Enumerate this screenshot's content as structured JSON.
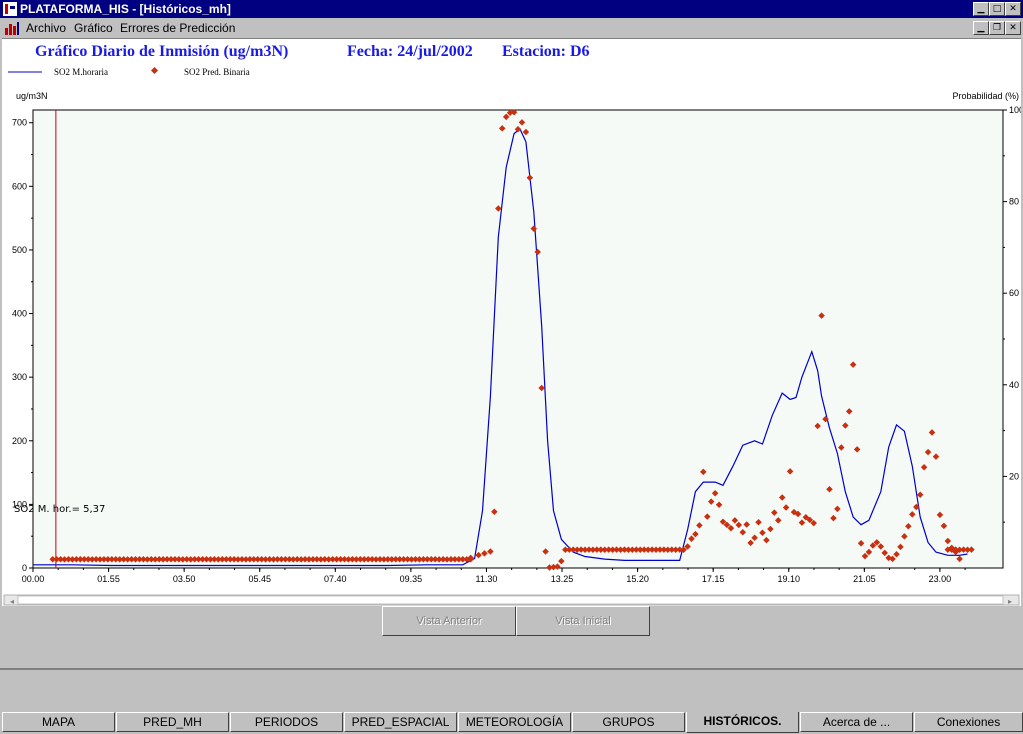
{
  "window": {
    "title": "PLATAFORMA_HIS - [Históricos_mh]"
  },
  "menu": {
    "archivo": "Archivo",
    "grafico": "Gráfico",
    "errores": "Errores de Predicción"
  },
  "chart_header": {
    "title": "Gráfico Diario de Inmisión (ug/m3N)",
    "fecha": "Fecha: 24/jul/2002",
    "estacion": "Estacion: D6"
  },
  "legend": {
    "line_label": "SO2 M.horaria",
    "dot_label": "SO2 Pred. Binaria",
    "line_color": "#0000cc",
    "dot_color": "#c83010"
  },
  "axes": {
    "left_unit": "ug/m3N",
    "right_unit": "Probabilidad (%)"
  },
  "cursor": {
    "readout": "SO2 M. hor.= 5,37"
  },
  "buttons": {
    "prev": "Vista Anterior",
    "initial": "Vista Inicial"
  },
  "tabs": [
    "MAPA",
    "PRED_MH",
    "PERIODOS",
    "PRED_ESPACIAL",
    "METEOROLOGÍA",
    "GRUPOS",
    "HISTÓRICOS.",
    "Acerca de ...",
    "Conexiones"
  ],
  "chart_data": {
    "type": "line",
    "x_unit": "hours",
    "x_ticks": [
      "00.00",
      "01.55",
      "03.50",
      "05.45",
      "07.40",
      "09.35",
      "11.30",
      "13.25",
      "15.20",
      "17.15",
      "19.10",
      "21.05",
      "23.00"
    ],
    "y_left": {
      "min": 0,
      "max": 720,
      "ticks": [
        0,
        100,
        200,
        300,
        400,
        500,
        600,
        700
      ]
    },
    "y_right": {
      "min": 0,
      "max": 100,
      "ticks": [
        20,
        40,
        60,
        80,
        100
      ]
    },
    "cursor_x": 0.58,
    "series": [
      {
        "name": "SO2 M.horaria",
        "axis": "left",
        "style": "line",
        "points": [
          [
            0,
            5
          ],
          [
            1,
            5
          ],
          [
            2,
            4
          ],
          [
            4,
            4
          ],
          [
            6,
            4
          ],
          [
            8,
            4
          ],
          [
            9,
            4
          ],
          [
            10,
            5
          ],
          [
            10.9,
            5
          ],
          [
            11.2,
            15
          ],
          [
            11.4,
            90
          ],
          [
            11.6,
            270
          ],
          [
            11.8,
            520
          ],
          [
            12,
            630
          ],
          [
            12.2,
            683
          ],
          [
            12.35,
            690
          ],
          [
            12.5,
            670
          ],
          [
            12.7,
            560
          ],
          [
            12.9,
            380
          ],
          [
            13.05,
            200
          ],
          [
            13.2,
            90
          ],
          [
            13.4,
            45
          ],
          [
            13.7,
            25
          ],
          [
            14,
            18
          ],
          [
            14.5,
            14
          ],
          [
            15,
            12
          ],
          [
            15.5,
            12
          ],
          [
            16,
            12
          ],
          [
            16.4,
            12
          ],
          [
            16.6,
            60
          ],
          [
            16.8,
            120
          ],
          [
            17,
            135
          ],
          [
            17.3,
            135
          ],
          [
            17.5,
            130
          ],
          [
            17.75,
            160
          ],
          [
            18,
            193
          ],
          [
            18.3,
            200
          ],
          [
            18.5,
            195
          ],
          [
            18.75,
            240
          ],
          [
            19,
            275
          ],
          [
            19.2,
            265
          ],
          [
            19.35,
            268
          ],
          [
            19.5,
            300
          ],
          [
            19.75,
            340
          ],
          [
            19.9,
            310
          ],
          [
            20,
            270
          ],
          [
            20.2,
            220
          ],
          [
            20.4,
            180
          ],
          [
            20.6,
            120
          ],
          [
            20.8,
            80
          ],
          [
            21,
            68
          ],
          [
            21.2,
            75
          ],
          [
            21.5,
            120
          ],
          [
            21.7,
            190
          ],
          [
            21.9,
            225
          ],
          [
            22.1,
            215
          ],
          [
            22.3,
            160
          ],
          [
            22.5,
            80
          ],
          [
            22.7,
            40
          ],
          [
            22.9,
            25
          ],
          [
            23.2,
            20
          ],
          [
            23.5,
            20
          ],
          [
            23.7,
            22
          ]
        ]
      },
      {
        "name": "SO2 Pred. Binaria",
        "axis": "right",
        "style": "markers",
        "uniform": [
          {
            "from": 0.5,
            "to": 11.1,
            "step": 0.1,
            "value": 1.9
          },
          {
            "from": 13.5,
            "to": 16.5,
            "step": 0.1,
            "value": 4.0
          },
          {
            "from": 23.2,
            "to": 23.8,
            "step": 0.1,
            "value": 4.0
          }
        ],
        "points": [
          [
            11.1,
            2.2
          ],
          [
            11.3,
            2.8
          ],
          [
            11.45,
            3.2
          ],
          [
            11.6,
            3.6
          ],
          [
            11.7,
            12.3
          ],
          [
            11.8,
            78.5
          ],
          [
            11.9,
            96.0
          ],
          [
            12.0,
            98.5
          ],
          [
            12.1,
            99.4
          ],
          [
            12.2,
            99.5
          ],
          [
            12.3,
            95.8
          ],
          [
            12.4,
            97.3
          ],
          [
            12.5,
            95.2
          ],
          [
            12.6,
            85.2
          ],
          [
            12.7,
            74.1
          ],
          [
            12.8,
            69.0
          ],
          [
            12.9,
            39.3
          ],
          [
            13.0,
            3.6
          ],
          [
            13.1,
            0.1
          ],
          [
            13.2,
            0.2
          ],
          [
            13.3,
            0.3
          ],
          [
            13.4,
            1.5
          ],
          [
            16.6,
            4.7
          ],
          [
            16.7,
            6.4
          ],
          [
            16.8,
            7.4
          ],
          [
            16.9,
            9.3
          ],
          [
            17.0,
            21.0
          ],
          [
            17.1,
            11.2
          ],
          [
            17.2,
            14.5
          ],
          [
            17.3,
            16.3
          ],
          [
            17.4,
            13.8
          ],
          [
            17.5,
            10.1
          ],
          [
            17.6,
            9.4
          ],
          [
            17.7,
            8.7
          ],
          [
            17.8,
            10.4
          ],
          [
            17.9,
            9.4
          ],
          [
            18.0,
            7.8
          ],
          [
            18.1,
            9.5
          ],
          [
            18.2,
            5.5
          ],
          [
            18.3,
            6.6
          ],
          [
            18.4,
            10.0
          ],
          [
            18.5,
            7.7
          ],
          [
            18.6,
            6.1
          ],
          [
            18.7,
            8.5
          ],
          [
            18.8,
            12.1
          ],
          [
            18.9,
            10.4
          ],
          [
            19.0,
            15.4
          ],
          [
            19.1,
            13.2
          ],
          [
            19.2,
            21.1
          ],
          [
            19.3,
            12.2
          ],
          [
            19.4,
            11.8
          ],
          [
            19.5,
            9.9
          ],
          [
            19.6,
            11.1
          ],
          [
            19.7,
            10.5
          ],
          [
            19.8,
            9.8
          ],
          [
            19.9,
            31.0
          ],
          [
            20.0,
            55.1
          ],
          [
            20.1,
            32.5
          ],
          [
            20.2,
            17.2
          ],
          [
            20.3,
            10.9
          ],
          [
            20.4,
            12.9
          ],
          [
            20.5,
            26.3
          ],
          [
            20.6,
            31.1
          ],
          [
            20.7,
            34.2
          ],
          [
            20.8,
            44.4
          ],
          [
            20.9,
            25.9
          ],
          [
            21.0,
            5.4
          ],
          [
            21.1,
            2.6
          ],
          [
            21.2,
            3.5
          ],
          [
            21.3,
            4.9
          ],
          [
            21.4,
            5.6
          ],
          [
            21.5,
            4.7
          ],
          [
            21.6,
            3.3
          ],
          [
            21.7,
            2.2
          ],
          [
            21.8,
            2.0
          ],
          [
            21.9,
            3.0
          ],
          [
            22.0,
            4.6
          ],
          [
            22.1,
            6.9
          ],
          [
            22.2,
            9.1
          ],
          [
            22.3,
            11.7
          ],
          [
            22.4,
            13.3
          ],
          [
            22.5,
            16.0
          ],
          [
            22.6,
            22.0
          ],
          [
            22.7,
            25.3
          ],
          [
            22.8,
            29.6
          ],
          [
            22.9,
            24.3
          ],
          [
            23.0,
            11.6
          ],
          [
            23.1,
            9.2
          ],
          [
            23.2,
            5.9
          ],
          [
            23.3,
            4.4
          ],
          [
            23.4,
            3.5
          ],
          [
            23.5,
            2.0
          ]
        ]
      }
    ]
  }
}
